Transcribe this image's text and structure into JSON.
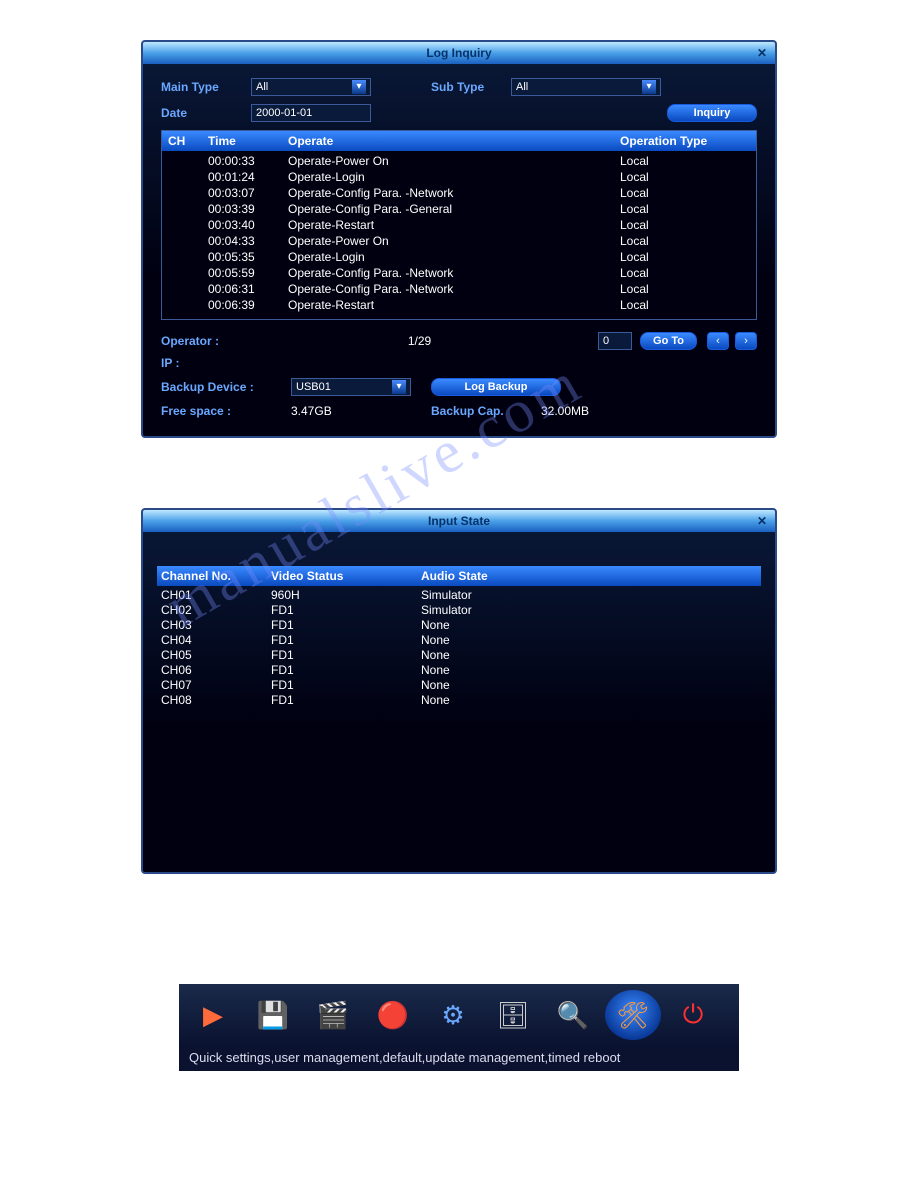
{
  "watermark_text": "manualslive.com",
  "log_window": {
    "title": "Log Inquiry",
    "main_type_label": "Main Type",
    "main_type_value": "All",
    "sub_type_label": "Sub Type",
    "sub_type_value": "All",
    "date_label": "Date",
    "date_value": "2000-01-01",
    "inquiry_btn": "Inquiry",
    "headers": {
      "ch": "CH",
      "time": "Time",
      "operate": "Operate",
      "op_type": "Operation Type"
    },
    "rows": [
      {
        "ch": "",
        "time": "00:00:33",
        "operate": "Operate-Power On",
        "type": "Local"
      },
      {
        "ch": "",
        "time": "00:01:24",
        "operate": "Operate-Login",
        "type": "Local"
      },
      {
        "ch": "",
        "time": "00:03:07",
        "operate": "Operate-Config Para. -Network",
        "type": "Local"
      },
      {
        "ch": "",
        "time": "00:03:39",
        "operate": "Operate-Config Para. -General",
        "type": "Local"
      },
      {
        "ch": "",
        "time": "00:03:40",
        "operate": "Operate-Restart",
        "type": "Local"
      },
      {
        "ch": "",
        "time": "00:04:33",
        "operate": "Operate-Power On",
        "type": "Local"
      },
      {
        "ch": "",
        "time": "00:05:35",
        "operate": "Operate-Login",
        "type": "Local"
      },
      {
        "ch": "",
        "time": "00:05:59",
        "operate": "Operate-Config Para. -Network",
        "type": "Local"
      },
      {
        "ch": "",
        "time": "00:06:31",
        "operate": "Operate-Config Para. -Network",
        "type": "Local"
      },
      {
        "ch": "",
        "time": "00:06:39",
        "operate": "Operate-Restart",
        "type": "Local"
      }
    ],
    "operator_label": "Operator :",
    "operator_value": "",
    "page_indicator": "1/29",
    "page_input": "0",
    "goto_btn": "Go To",
    "ip_label": "IP :",
    "backup_device_label": "Backup Device :",
    "backup_device_value": "USB01",
    "log_backup_btn": "Log Backup",
    "free_space_label": "Free space :",
    "free_space_value": "3.47GB",
    "backup_cap_label": "Backup Cap.",
    "backup_cap_value": "32.00MB"
  },
  "input_state_window": {
    "title": "Input State",
    "headers": {
      "ch": "Channel No.",
      "video": "Video Status",
      "audio": "Audio State"
    },
    "rows": [
      {
        "ch": "CH01",
        "video": "960H",
        "audio": "Simulator"
      },
      {
        "ch": "CH02",
        "video": "FD1",
        "audio": "Simulator"
      },
      {
        "ch": "CH03",
        "video": "FD1",
        "audio": "None"
      },
      {
        "ch": "CH04",
        "video": "FD1",
        "audio": "None"
      },
      {
        "ch": "CH05",
        "video": "FD1",
        "audio": "None"
      },
      {
        "ch": "CH06",
        "video": "FD1",
        "audio": "None"
      },
      {
        "ch": "CH07",
        "video": "FD1",
        "audio": "None"
      },
      {
        "ch": "CH08",
        "video": "FD1",
        "audio": "None"
      }
    ]
  },
  "toolbar": {
    "caption": "Quick settings,user management,default,update management,timed reboot",
    "items": [
      {
        "name": "play-icon",
        "glyph": "▶",
        "color": "#ff6a3a"
      },
      {
        "name": "save-icon",
        "glyph": "💾",
        "color": "#6aa8ff"
      },
      {
        "name": "media-icon",
        "glyph": "🎬",
        "color": "#ffcc33"
      },
      {
        "name": "record-settings-icon",
        "glyph": "🔴",
        "color": "#ff3a3a"
      },
      {
        "name": "gears-icon",
        "glyph": "⚙",
        "color": "#6aa8ff"
      },
      {
        "name": "disk-icon",
        "glyph": "🗄",
        "color": "#cccccc"
      },
      {
        "name": "search-icon",
        "glyph": "🔍",
        "color": "#ffcc66"
      },
      {
        "name": "tools-icon",
        "glyph": "🛠",
        "color": "#ff9a3a",
        "active": true
      },
      {
        "name": "power-icon",
        "glyph": "⏻",
        "color": "#ff3030"
      }
    ]
  }
}
